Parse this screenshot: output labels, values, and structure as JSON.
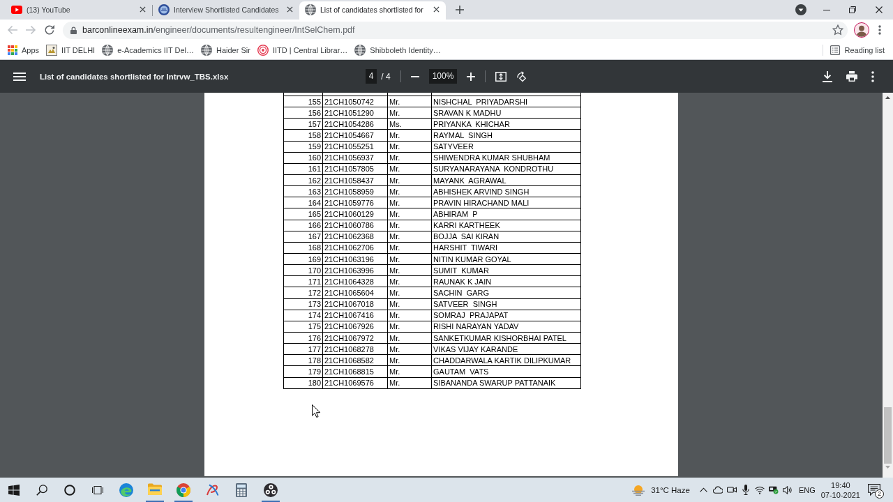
{
  "browser": {
    "tabs": [
      {
        "title": "(13) YouTube",
        "selected": false
      },
      {
        "title": "Interview Shortlisted Candidates",
        "selected": false
      },
      {
        "title": "List of candidates shortlisted for",
        "selected": true
      }
    ],
    "navigation": {
      "back": {
        "disabled": true
      },
      "forward": {
        "disabled": true
      }
    },
    "address_bar": {
      "host": "barconlineexam.in",
      "path": "/engineer/documents/resultengineer/IntSelChem.pdf"
    },
    "bookmarks": [
      "Apps",
      "IIT DELHI",
      "e-Academics IIT Del…",
      "Haider Sir",
      "IITD | Central Librar…",
      "Shibboleth Identity…"
    ],
    "reading_list": "Reading list"
  },
  "pdf_viewer": {
    "title": "List of candidates shortlisted for Intrvw_TBS.xlsx",
    "page": "4",
    "page_total": "/ 4",
    "zoom": "100%",
    "table": {
      "rows": [
        {
          "serial": "155",
          "roll_no": "21CH1050742",
          "salutation": "Mr.",
          "name": "NISHCHAL  PRIYADARSHI"
        },
        {
          "serial": "156",
          "roll_no": "21CH1051290",
          "salutation": "Mr.",
          "name": "SRAVAN K MADHU"
        },
        {
          "serial": "157",
          "roll_no": "21CH1054286",
          "salutation": "Ms.",
          "name": "PRIYANKA  KHICHAR"
        },
        {
          "serial": "158",
          "roll_no": "21CH1054667",
          "salutation": "Mr.",
          "name": "RAYMAL  SINGH"
        },
        {
          "serial": "159",
          "roll_no": "21CH1055251",
          "salutation": "Mr.",
          "name": "SATYVEER"
        },
        {
          "serial": "160",
          "roll_no": "21CH1056937",
          "salutation": "Mr.",
          "name": "SHIWENDRA KUMAR SHUBHAM"
        },
        {
          "serial": "161",
          "roll_no": "21CH1057805",
          "salutation": "Mr.",
          "name": "SURYANARAYANA  KONDROTHU"
        },
        {
          "serial": "162",
          "roll_no": "21CH1058437",
          "salutation": "Mr.",
          "name": "MAYANK  AGRAWAL"
        },
        {
          "serial": "163",
          "roll_no": "21CH1058959",
          "salutation": "Mr.",
          "name": "ABHISHEK ARVIND SINGH"
        },
        {
          "serial": "164",
          "roll_no": "21CH1059776",
          "salutation": "Mr.",
          "name": "PRAVIN HIRACHAND MALI"
        },
        {
          "serial": "165",
          "roll_no": "21CH1060129",
          "salutation": "Mr.",
          "name": "ABHIRAM  P"
        },
        {
          "serial": "166",
          "roll_no": "21CH1060786",
          "salutation": "Mr.",
          "name": "KARRI KARTHEEK"
        },
        {
          "serial": "167",
          "roll_no": "21CH1062368",
          "salutation": "Mr.",
          "name": "BOJJA  SAI KIRAN"
        },
        {
          "serial": "168",
          "roll_no": "21CH1062706",
          "salutation": "Mr.",
          "name": "HARSHIT  TIWARI"
        },
        {
          "serial": "169",
          "roll_no": "21CH1063196",
          "salutation": "Mr.",
          "name": "NITIN KUMAR GOYAL"
        },
        {
          "serial": "170",
          "roll_no": "21CH1063996",
          "salutation": "Mr.",
          "name": "SUMIT  KUMAR"
        },
        {
          "serial": "171",
          "roll_no": "21CH1064328",
          "salutation": "Mr.",
          "name": "RAUNAK K JAIN"
        },
        {
          "serial": "172",
          "roll_no": "21CH1065604",
          "salutation": "Mr.",
          "name": "SACHIN  GARG"
        },
        {
          "serial": "173",
          "roll_no": "21CH1067018",
          "salutation": "Mr.",
          "name": "SATVEER  SINGH"
        },
        {
          "serial": "174",
          "roll_no": "21CH1067416",
          "salutation": "Mr.",
          "name": "SOMRAJ  PRAJAPAT"
        },
        {
          "serial": "175",
          "roll_no": "21CH1067926",
          "salutation": "Mr.",
          "name": "RISHI NARAYAN YADAV"
        },
        {
          "serial": "176",
          "roll_no": "21CH1067972",
          "salutation": "Mr.",
          "name": "SANKETKUMAR KISHORBHAI PATEL"
        },
        {
          "serial": "177",
          "roll_no": "21CH1068278",
          "salutation": "Mr.",
          "name": "VIKAS VIJAY KARANDE"
        },
        {
          "serial": "178",
          "roll_no": "21CH1068582",
          "salutation": "Mr.",
          "name": "CHADDARWALA KARTIK DILIPKUMAR"
        },
        {
          "serial": "179",
          "roll_no": "21CH1068815",
          "salutation": "Mr.",
          "name": "GAUTAM  VATS"
        },
        {
          "serial": "180",
          "roll_no": "21CH1069576",
          "salutation": "Mr.",
          "name": "SIBANANDA SWARUP PATTANAIK"
        }
      ]
    }
  },
  "taskbar": {
    "apps": [
      {
        "running": false
      },
      {
        "running": true
      },
      {
        "running": true
      },
      {
        "running": false
      },
      {
        "running": false
      },
      {
        "running": true
      }
    ],
    "weather": "31°C Haze",
    "language": "ENG",
    "time": "19:40",
    "date": "07-10-2021",
    "notification_count": "2"
  }
}
